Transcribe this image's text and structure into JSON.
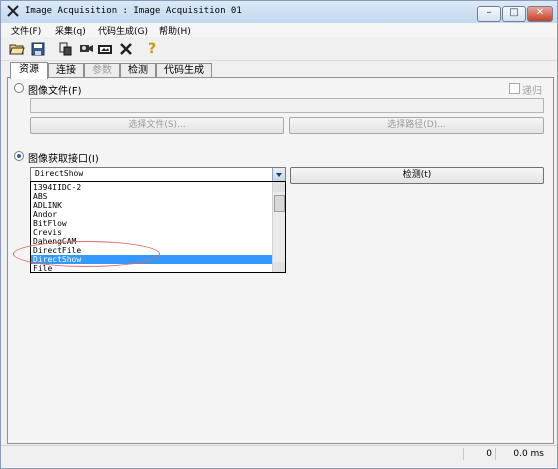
{
  "window": {
    "title": "Image Acquisition : Image Acquisition 01"
  },
  "menu": [
    "文件(F)",
    "采集(q)",
    "代码生成(G)",
    "帮助(H)"
  ],
  "toolbar": {
    "icons": [
      "open-folder-icon",
      "save-icon",
      "load-icon",
      "connect-icon",
      "snapshot-icon",
      "settings-icon",
      "help-icon"
    ],
    "help_glyph": "?"
  },
  "tabs": [
    {
      "label": "资源",
      "state": "active"
    },
    {
      "label": "连接",
      "state": "normal"
    },
    {
      "label": "参数",
      "state": "disabled"
    },
    {
      "label": "检测",
      "state": "normal"
    },
    {
      "label": "代码生成",
      "state": "normal"
    }
  ],
  "image_files": {
    "radio_label": "图像文件(F)",
    "recursive_label": "递归",
    "select_file_label": "选择文件(S)...",
    "select_path_label": "选择路径(D)..."
  },
  "acquisition": {
    "radio_label": "图像获取接口(I)",
    "selected_value": "DirectShow",
    "detect_label": "检测(t)",
    "options": [
      "1394IIDC-2",
      "ABS",
      "ADLINK",
      "Andor",
      "BitFlow",
      "Crevis",
      "DahengCAM",
      "DirectFile",
      "DirectShow",
      "File"
    ]
  },
  "status": {
    "count": "0",
    "time": "0.0 ms"
  },
  "colors": {
    "selection": "#3399ff",
    "annotation": "#e06a6a"
  }
}
